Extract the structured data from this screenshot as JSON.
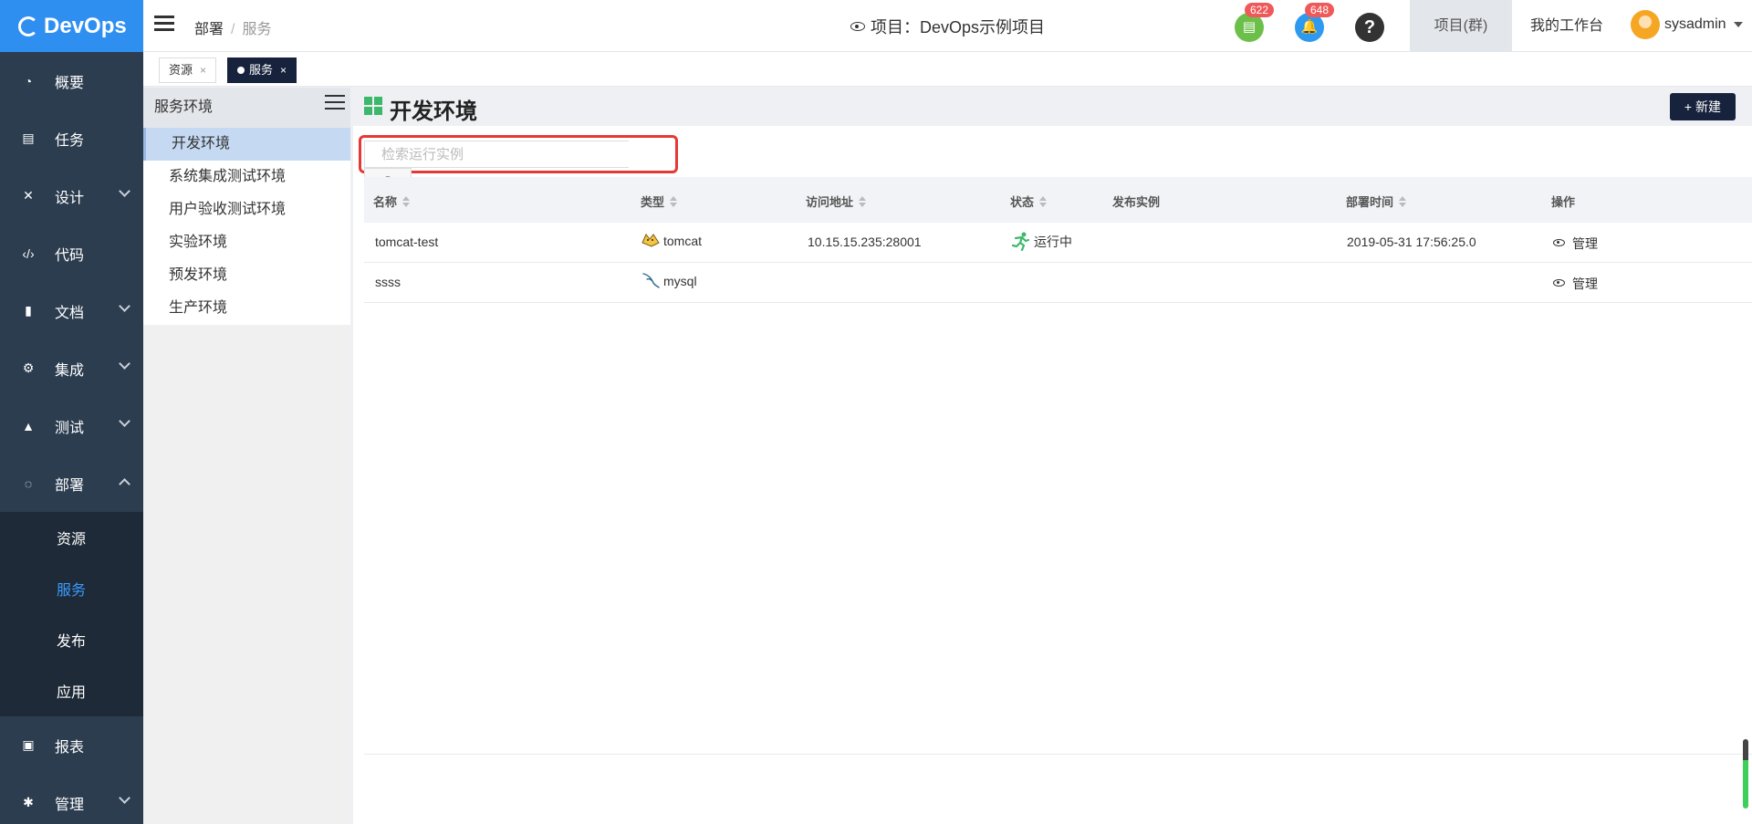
{
  "app": {
    "logo": "DevOps"
  },
  "sidebar": {
    "items": [
      {
        "label": "概要",
        "icon": "dashboard-icon"
      },
      {
        "label": "任务",
        "icon": "task-icon"
      },
      {
        "label": "设计",
        "icon": "design-icon"
      },
      {
        "label": "代码",
        "icon": "code-icon"
      },
      {
        "label": "文档",
        "icon": "document-icon"
      },
      {
        "label": "集成",
        "icon": "integration-icon"
      },
      {
        "label": "测试",
        "icon": "flask-icon"
      },
      {
        "label": "部署",
        "icon": "deploy-icon"
      },
      {
        "label": "报表",
        "icon": "report-icon"
      },
      {
        "label": "管理",
        "icon": "gear-icon"
      }
    ],
    "deploy_sub": [
      "资源",
      "服务",
      "发布",
      "应用"
    ],
    "active_sub": "服务"
  },
  "topbar": {
    "breadcrumb": [
      "部署",
      "服务"
    ],
    "project_title": "项目：DevOps示例项目",
    "badges": {
      "docs": "622",
      "bell": "648"
    },
    "help": "?",
    "tabs": [
      "项目(群)",
      "我的工作台"
    ],
    "user": "sysadmin"
  },
  "tabstrip": {
    "tags": [
      "资源",
      "服务"
    ],
    "close": "×"
  },
  "envpanel": {
    "title": "服务环境",
    "items": [
      "开发环境",
      "系统集成测试环境",
      "用户验收测试环境",
      "实验环境",
      "预发环境",
      "生产环境"
    ],
    "active": "开发环境"
  },
  "main": {
    "title": "开发环境",
    "new_button": "+ 新建",
    "search_placeholder": "检索运行实例",
    "columns": [
      "名称",
      "类型",
      "访问地址",
      "状态",
      "发布实例",
      "部署时间",
      "操作"
    ],
    "rows": [
      {
        "name": "tomcat-test",
        "type": "tomcat",
        "type_icon": "tomcat-icon",
        "address": "10.15.15.235:28001",
        "status": "运行中",
        "status_icon": "running-icon",
        "release": "",
        "deployed": "2019-05-31 17:56:25.0",
        "action": "管理"
      },
      {
        "name": "ssss",
        "type": "mysql",
        "type_icon": "mysql-icon",
        "address": "",
        "status": "",
        "release": "",
        "deployed": "",
        "action": "管理"
      }
    ]
  },
  "colors": {
    "sidebar": "#2c3d50",
    "logo_bg": "#2f8ff0",
    "active_sub": "#3a9bff",
    "dark_button": "#17233d",
    "search_highlight": "#e53935",
    "running": "#3db86b",
    "badge": "#f0595a"
  }
}
